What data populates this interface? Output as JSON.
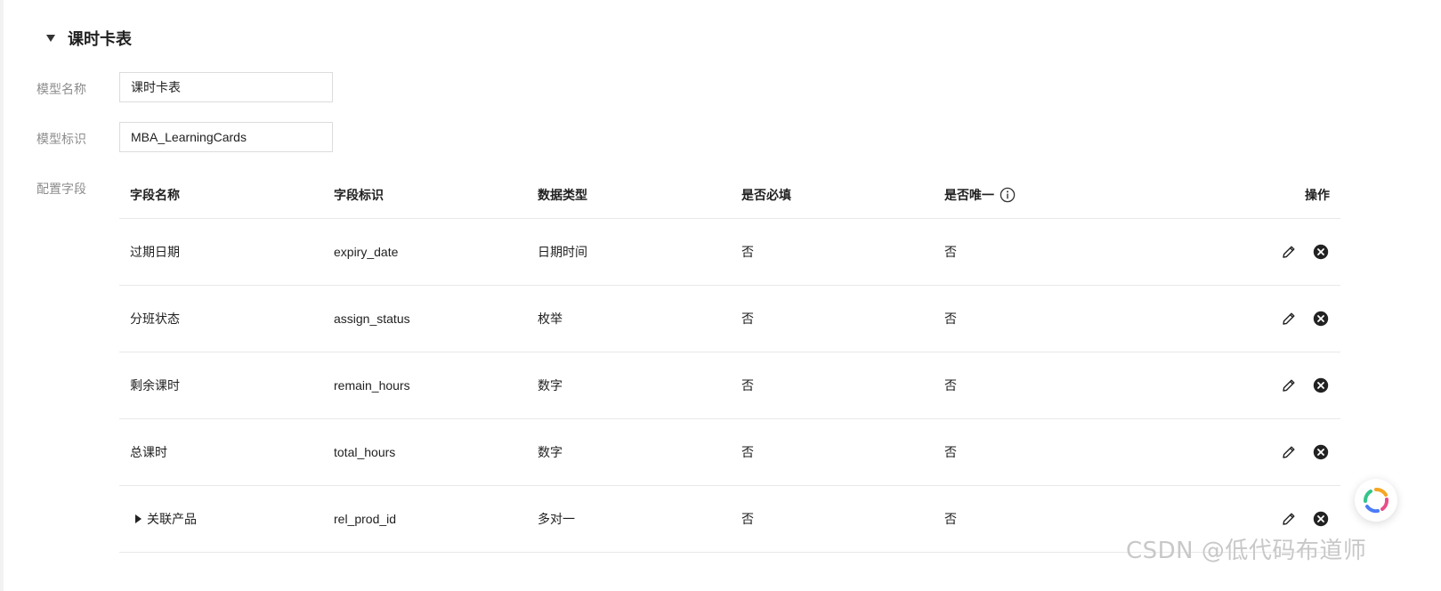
{
  "section": {
    "title": "课时卡表"
  },
  "form": {
    "model_name_label": "模型名称",
    "model_name_value": "课时卡表",
    "model_id_label": "模型标识",
    "model_id_value": "MBA_LearningCards",
    "fields_label": "配置字段"
  },
  "table": {
    "columns": [
      "字段名称",
      "字段标识",
      "数据类型",
      "是否必填",
      "是否唯一",
      "操作"
    ],
    "rows": [
      {
        "name": "过期日期",
        "identifier": "expiry_date",
        "type": "日期时间",
        "required": "否",
        "unique": "否"
      },
      {
        "name": "分班状态",
        "identifier": "assign_status",
        "type": "枚举",
        "required": "否",
        "unique": "否"
      },
      {
        "name": "剩余课时",
        "identifier": "remain_hours",
        "type": "数字",
        "required": "否",
        "unique": "否"
      },
      {
        "name": "总课时",
        "identifier": "total_hours",
        "type": "数字",
        "required": "否",
        "unique": "否"
      },
      {
        "name": "关联产品",
        "identifier": "rel_prod_id",
        "type": "多对一",
        "required": "否",
        "unique": "否"
      }
    ]
  },
  "icons": {
    "section_toggle": "caret-down-icon",
    "unique_info": "info-icon",
    "edit": "pencil-icon",
    "delete": "close-circle-icon",
    "row_expand": "caret-right-icon",
    "floating": "assistant-logo-icon"
  },
  "watermark": "CSDN @低代码布道师"
}
